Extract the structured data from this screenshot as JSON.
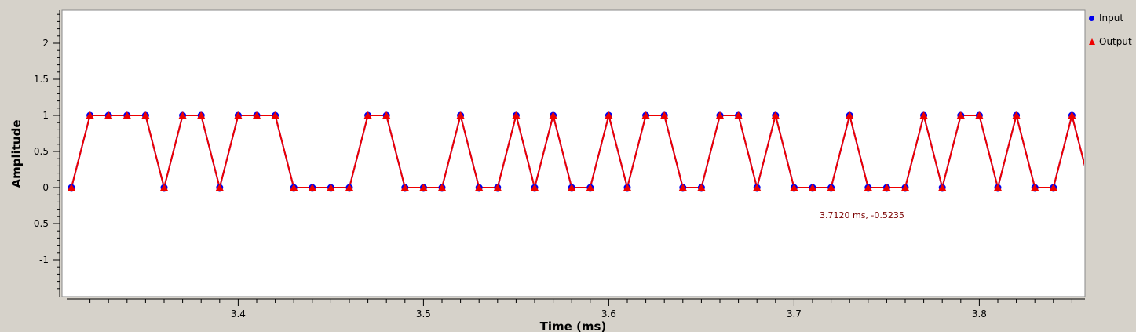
{
  "chart_data": {
    "type": "line",
    "xlabel": "Time (ms)",
    "ylabel": "Amplitude",
    "xlim": [
      3.31,
      3.86
    ],
    "ylim": [
      -1.5,
      2.45
    ],
    "x_ticks": [
      3.4,
      3.5,
      3.6,
      3.7,
      3.8
    ],
    "x_tick_labels": [
      "3.4",
      "3.5",
      "3.6",
      "3.7",
      "3.8"
    ],
    "y_ticks": [
      -1,
      -0.5,
      0,
      0.5,
      1,
      1.5,
      2
    ],
    "y_tick_labels": [
      "-1",
      "-0.5",
      "0",
      "0.5",
      "1",
      "1.5",
      "2"
    ],
    "x": [
      3.31,
      3.32,
      3.33,
      3.34,
      3.35,
      3.36,
      3.37,
      3.38,
      3.39,
      3.4,
      3.41,
      3.42,
      3.43,
      3.44,
      3.45,
      3.46,
      3.47,
      3.48,
      3.49,
      3.5,
      3.51,
      3.52,
      3.53,
      3.54,
      3.55,
      3.56,
      3.57,
      3.58,
      3.59,
      3.6,
      3.61,
      3.62,
      3.63,
      3.64,
      3.65,
      3.66,
      3.67,
      3.68,
      3.69,
      3.7,
      3.71,
      3.72,
      3.73,
      3.74,
      3.75,
      3.76,
      3.77,
      3.78,
      3.79,
      3.8,
      3.81,
      3.82,
      3.83,
      3.84,
      3.85,
      3.86
    ],
    "series": [
      {
        "name": "Input",
        "color": "#0000ee",
        "marker": "circle",
        "values": [
          0,
          1,
          1,
          1,
          1,
          0,
          1,
          1,
          0,
          1,
          1,
          1,
          0,
          0,
          0,
          0,
          1,
          1,
          0,
          0,
          0,
          1,
          0,
          0,
          1,
          0,
          1,
          0,
          0,
          1,
          0,
          1,
          1,
          0,
          0,
          1,
          1,
          0,
          1,
          0,
          0,
          0,
          1,
          0,
          0,
          0,
          1,
          0,
          1,
          1,
          0,
          1,
          0,
          0,
          1,
          0
        ]
      },
      {
        "name": "Output",
        "color": "#ee0000",
        "marker": "triangle",
        "values": [
          0,
          1,
          1,
          1,
          1,
          0,
          1,
          1,
          0,
          1,
          1,
          1,
          0,
          0,
          0,
          0,
          1,
          1,
          0,
          0,
          0,
          1,
          0,
          0,
          1,
          0,
          1,
          0,
          0,
          1,
          0,
          1,
          1,
          0,
          0,
          1,
          1,
          0,
          1,
          0,
          0,
          0,
          1,
          0,
          0,
          0,
          1,
          0,
          1,
          1,
          0,
          1,
          0,
          0,
          1,
          0
        ]
      }
    ],
    "legend": "right",
    "grid": false
  },
  "readout": "3.7120 ms, -0.5235",
  "legend": {
    "items": [
      {
        "label": "Input"
      },
      {
        "label": "Output"
      }
    ]
  }
}
